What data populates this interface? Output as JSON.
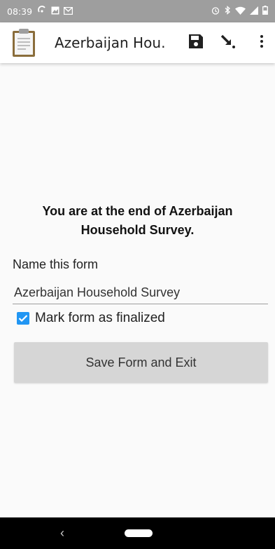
{
  "status_bar": {
    "time": "08:39",
    "icons_left": [
      "sync-icon",
      "image-icon",
      "gmail-icon"
    ],
    "icons_right": [
      "alarm-icon",
      "bluetooth-icon",
      "wifi-icon",
      "signal-icon",
      "battery-icon"
    ]
  },
  "app_bar": {
    "title": "Azerbaijan Hou…",
    "actions": [
      "save-icon",
      "goto-icon",
      "more-vert-icon"
    ]
  },
  "form_end": {
    "message": "You are at the end of Azerbaijan Household Survey.",
    "name_label": "Name this form",
    "name_value": "Azerbaijan Household Survey",
    "finalize_label": "Mark form as finalized",
    "finalize_checked": true,
    "save_button_label": "Save Form and Exit"
  },
  "colors": {
    "status_bar": "#9e9e9e",
    "accent": "#2196f3",
    "button_bg": "#d6d6d6"
  }
}
